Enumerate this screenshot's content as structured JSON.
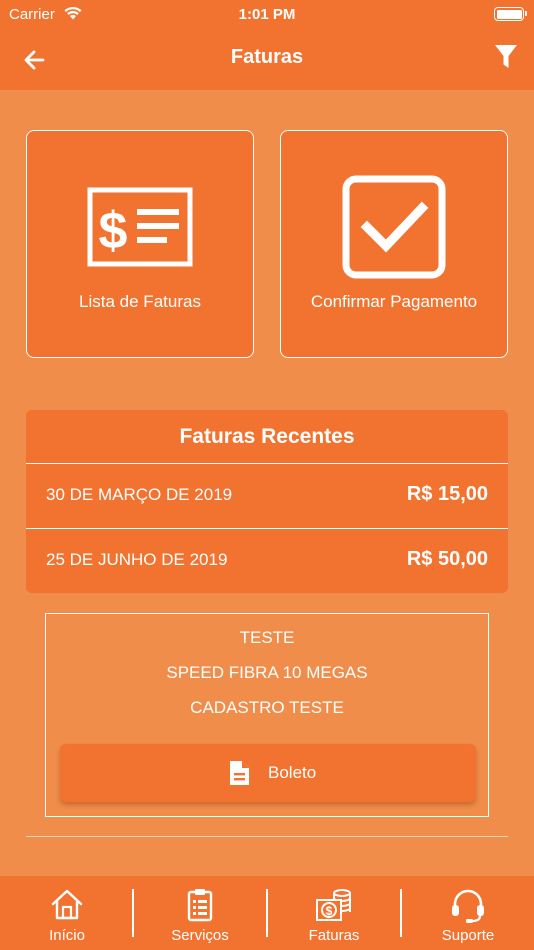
{
  "status_bar": {
    "carrier": "Carrier",
    "time": "1:01 PM"
  },
  "nav": {
    "title": "Faturas",
    "back_icon": "arrow-left-icon",
    "filter_icon": "filter-icon"
  },
  "tiles": [
    {
      "label": "Lista de Faturas",
      "icon": "invoice-dollar-icon"
    },
    {
      "label": "Confirmar Pagamento",
      "icon": "checkbox-check-icon"
    }
  ],
  "recent": {
    "title": "Faturas Recentes",
    "items": [
      {
        "date": "30 DE MARÇO DE 2019",
        "amount": "R$ 15,00"
      },
      {
        "date": "25 DE JUNHO DE 2019",
        "amount": "R$ 50,00"
      }
    ]
  },
  "detail": {
    "line1": "TESTE",
    "line2": "SPEED FIBRA 10 MEGAS",
    "line3": "CADASTRO TESTE",
    "button_label": "Boleto",
    "button_icon": "document-icon"
  },
  "tabs": [
    {
      "label": "Início",
      "icon": "home-icon"
    },
    {
      "label": "Serviços",
      "icon": "clipboard-list-icon"
    },
    {
      "label": "Faturas",
      "icon": "money-coins-icon"
    },
    {
      "label": "Suporte",
      "icon": "headset-icon"
    }
  ],
  "colors": {
    "background": "#F18D4A",
    "primary": "#F27330",
    "text": "#FFFFFF"
  }
}
